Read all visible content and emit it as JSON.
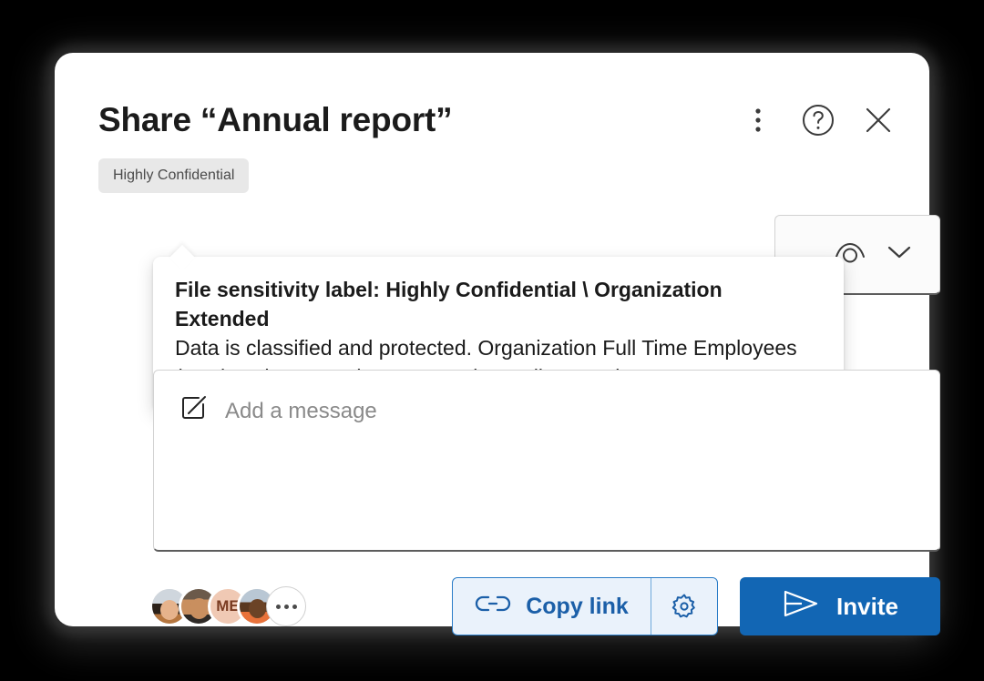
{
  "dialog": {
    "title": "Share “Annual report”",
    "sensitivity_badge": "Highly Confidential"
  },
  "header_icons": [
    {
      "name": "more-options-icon",
      "label": "More options"
    },
    {
      "name": "help-icon",
      "label": "Help"
    },
    {
      "name": "close-icon",
      "label": "Close"
    }
  ],
  "tooltip": {
    "line1": "File sensitivity label: Highly Confidential \\ Organization Extended",
    "line2": "Data is classified and protected. Organization Full Time Employees",
    "line3": "(FTE) and non employees can view, edit, or reply."
  },
  "permission": {
    "icon": "view-eye-icon",
    "chevron": "chevron-down-icon"
  },
  "message": {
    "icon": "edit-pencil-icon",
    "placeholder": "Add a message",
    "value": ""
  },
  "people": [
    {
      "name": "avatar-person-1",
      "type": "photo"
    },
    {
      "name": "avatar-person-2",
      "type": "photo"
    },
    {
      "name": "avatar-person-me",
      "type": "initials",
      "initials": "ME"
    },
    {
      "name": "avatar-person-4",
      "type": "photo"
    },
    {
      "name": "avatar-overflow",
      "type": "more"
    }
  ],
  "actions": {
    "copy_link_label": "Copy link",
    "copy_link_icon": "link-icon",
    "copy_link_settings_icon": "gear-icon",
    "invite_label": "Invite",
    "invite_icon": "send-icon"
  },
  "colors": {
    "primary": "#1266b4",
    "secondary_bg": "#eaf2fb",
    "secondary_border": "#2a7cc7",
    "badge_bg": "#e8e8e8",
    "avatar_initials_bg": "#f0c9b4"
  }
}
